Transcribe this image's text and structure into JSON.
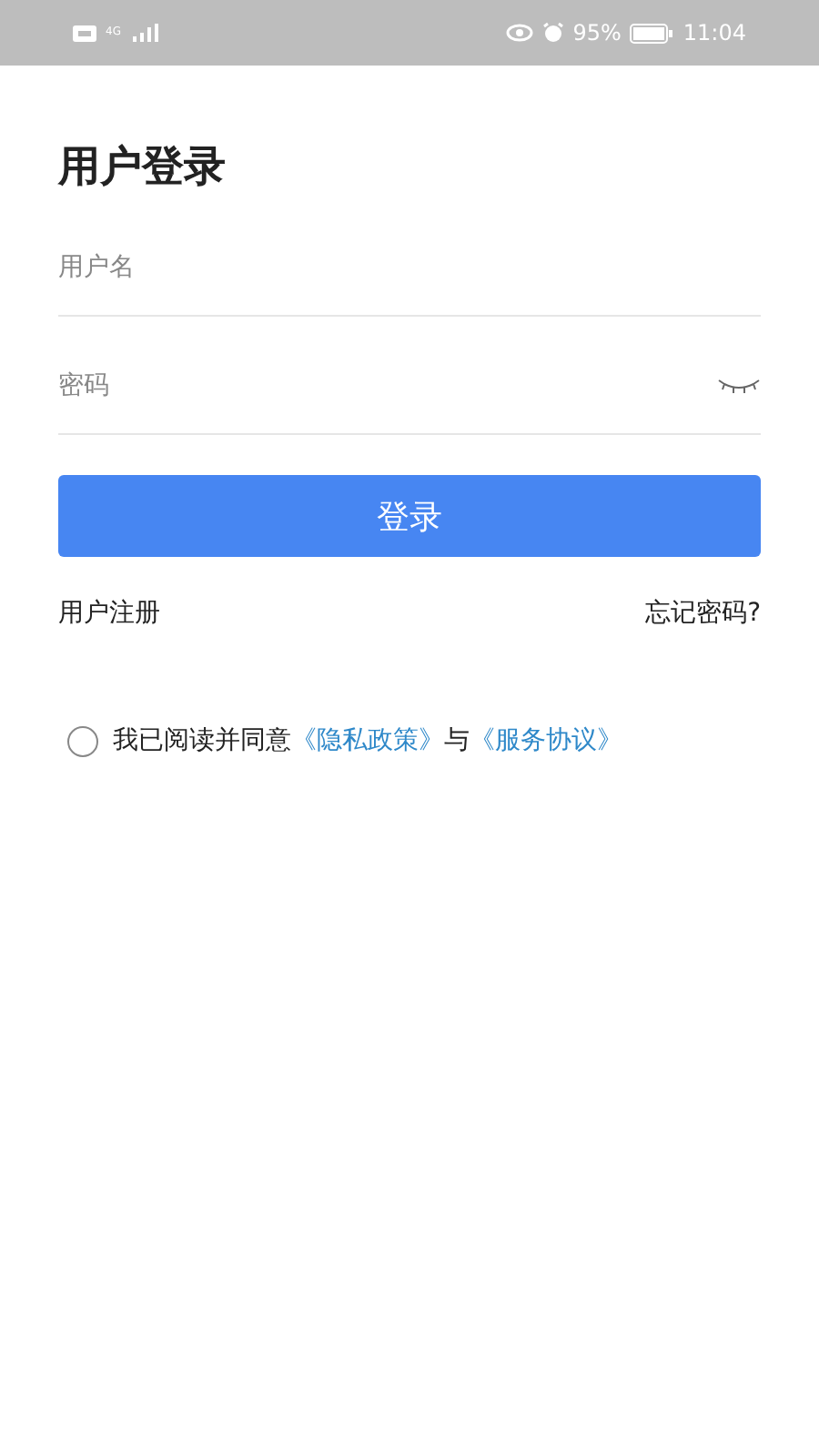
{
  "status_bar": {
    "network": "4G",
    "battery": "95%",
    "time": "11:04"
  },
  "title": "用户登录",
  "username": {
    "placeholder": "用户名"
  },
  "password": {
    "placeholder": "密码",
    "visible": false
  },
  "login_button": "登录",
  "links": [
    {
      "label": "用户注册"
    },
    {
      "label": "忘记密码?"
    }
  ],
  "agreement": {
    "checked": false,
    "text": "我已阅读并同意",
    "privacy_link": "《隐私政策》",
    "joiner": "与",
    "service_link": "《服务协议》"
  }
}
